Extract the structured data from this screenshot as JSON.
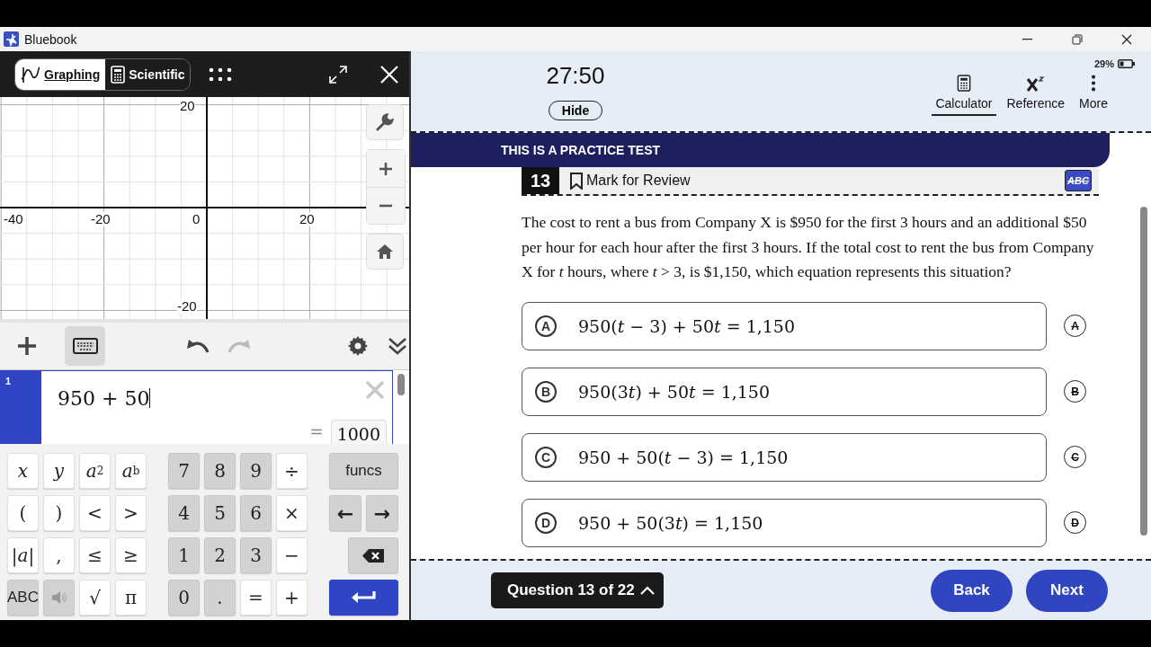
{
  "window": {
    "title": "Bluebook"
  },
  "calculator": {
    "tabs": [
      {
        "label": "Graphing",
        "selected": true
      },
      {
        "label": "Scientific",
        "selected": false
      }
    ],
    "graph": {
      "x_ticks": [
        "-40",
        "-20",
        "0",
        "20"
      ],
      "y_ticks": [
        "20",
        "-20"
      ]
    },
    "expressions": [
      {
        "index": "1",
        "input": "950 + 50",
        "equals": "=",
        "result": "1000",
        "selected": true
      }
    ],
    "keypad": {
      "left": [
        {
          "label": "x",
          "kind": "var"
        },
        {
          "label": "y",
          "kind": "var"
        },
        {
          "label": "*a*$^{2}$",
          "kind": "light"
        },
        {
          "label": "*a*$^{b}$",
          "kind": "light"
        },
        {
          "label": "(",
          "kind": "light"
        },
        {
          "label": ")",
          "kind": "light"
        },
        {
          "label": "<",
          "kind": "light"
        },
        {
          "label": ">",
          "kind": "light"
        },
        {
          "label": "|*a*|",
          "kind": "light"
        },
        {
          "label": ",",
          "kind": "light"
        },
        {
          "label": "≤",
          "kind": "light"
        },
        {
          "label": "≥",
          "kind": "light"
        },
        {
          "label": "ABC",
          "kind": "dark-sans"
        },
        {
          "kind": "speaker"
        },
        {
          "label": "√",
          "kind": "light"
        },
        {
          "label": "π",
          "kind": "light"
        }
      ],
      "numbers": [
        {
          "label": "7",
          "kind": "dark"
        },
        {
          "label": "8",
          "kind": "dark"
        },
        {
          "label": "9",
          "kind": "dark"
        },
        {
          "label": "÷",
          "kind": "light"
        },
        {
          "label": "4",
          "kind": "dark"
        },
        {
          "label": "5",
          "kind": "dark"
        },
        {
          "label": "6",
          "kind": "dark"
        },
        {
          "label": "×",
          "kind": "light"
        },
        {
          "label": "1",
          "kind": "dark"
        },
        {
          "label": "2",
          "kind": "dark"
        },
        {
          "label": "3",
          "kind": "dark"
        },
        {
          "label": "−",
          "kind": "light"
        },
        {
          "label": "0",
          "kind": "dark"
        },
        {
          "label": ".",
          "kind": "dark"
        },
        {
          "label": "=",
          "kind": "light"
        },
        {
          "label": "+",
          "kind": "light"
        }
      ],
      "right": [
        {
          "label": "funcs",
          "kind": "wide"
        },
        {
          "label": "←",
          "kind": "half"
        },
        {
          "label": "→",
          "kind": "half"
        },
        {
          "kind": "backspace"
        },
        {
          "kind": "enter"
        }
      ]
    }
  },
  "test": {
    "timer": "27:50",
    "hide_button": "Hide",
    "battery": "29%",
    "tools": [
      {
        "label": "Calculator",
        "selected": true
      },
      {
        "label": "Reference",
        "selected": false
      },
      {
        "label": "More",
        "selected": false
      }
    ],
    "banner": "THIS IS A PRACTICE TEST",
    "question": {
      "number": "13",
      "mark_label": "Mark for Review",
      "marked": false,
      "eliminator_label": "ABC",
      "text": "The cost to rent a bus from Company X is $950 for the first 3 hours and an additional $50 per hour for each hour after the first 3 hours. If the total cost to rent the bus from Company X for *t* hours, where *t* > 3, is $1,150, which equation represents this situation?",
      "choices": [
        {
          "letter": "A",
          "parts": [
            {
              "text": "950(",
              "italic": false
            },
            {
              "text": "t",
              "italic": true
            },
            {
              "text": " − 3) + 50",
              "italic": false
            },
            {
              "text": "t",
              "italic": true
            },
            {
              "text": " = 1,150",
              "italic": false
            }
          ],
          "strike_label": "A",
          "selected": false
        },
        {
          "letter": "B",
          "parts": [
            {
              "text": "950(3",
              "italic": false
            },
            {
              "text": "t",
              "italic": true
            },
            {
              "text": ") + 50",
              "italic": false
            },
            {
              "text": "t",
              "italic": true
            },
            {
              "text": " = 1,150",
              "italic": false
            }
          ],
          "strike_label": "B",
          "selected": false
        },
        {
          "letter": "C",
          "parts": [
            {
              "text": "950 + 50(",
              "italic": false
            },
            {
              "text": "t",
              "italic": true
            },
            {
              "text": " − 3) = 1,150",
              "italic": false
            }
          ],
          "strike_label": "C",
          "selected": false
        },
        {
          "letter": "D",
          "parts": [
            {
              "text": "950 + 50(3",
              "italic": false
            },
            {
              "text": "t",
              "italic": true
            },
            {
              "text": ") = 1,150",
              "italic": false
            }
          ],
          "strike_label": "D",
          "selected": false
        }
      ]
    },
    "nav": {
      "progress": "Question 13 of 22",
      "back": "Back",
      "next": "Next"
    }
  }
}
